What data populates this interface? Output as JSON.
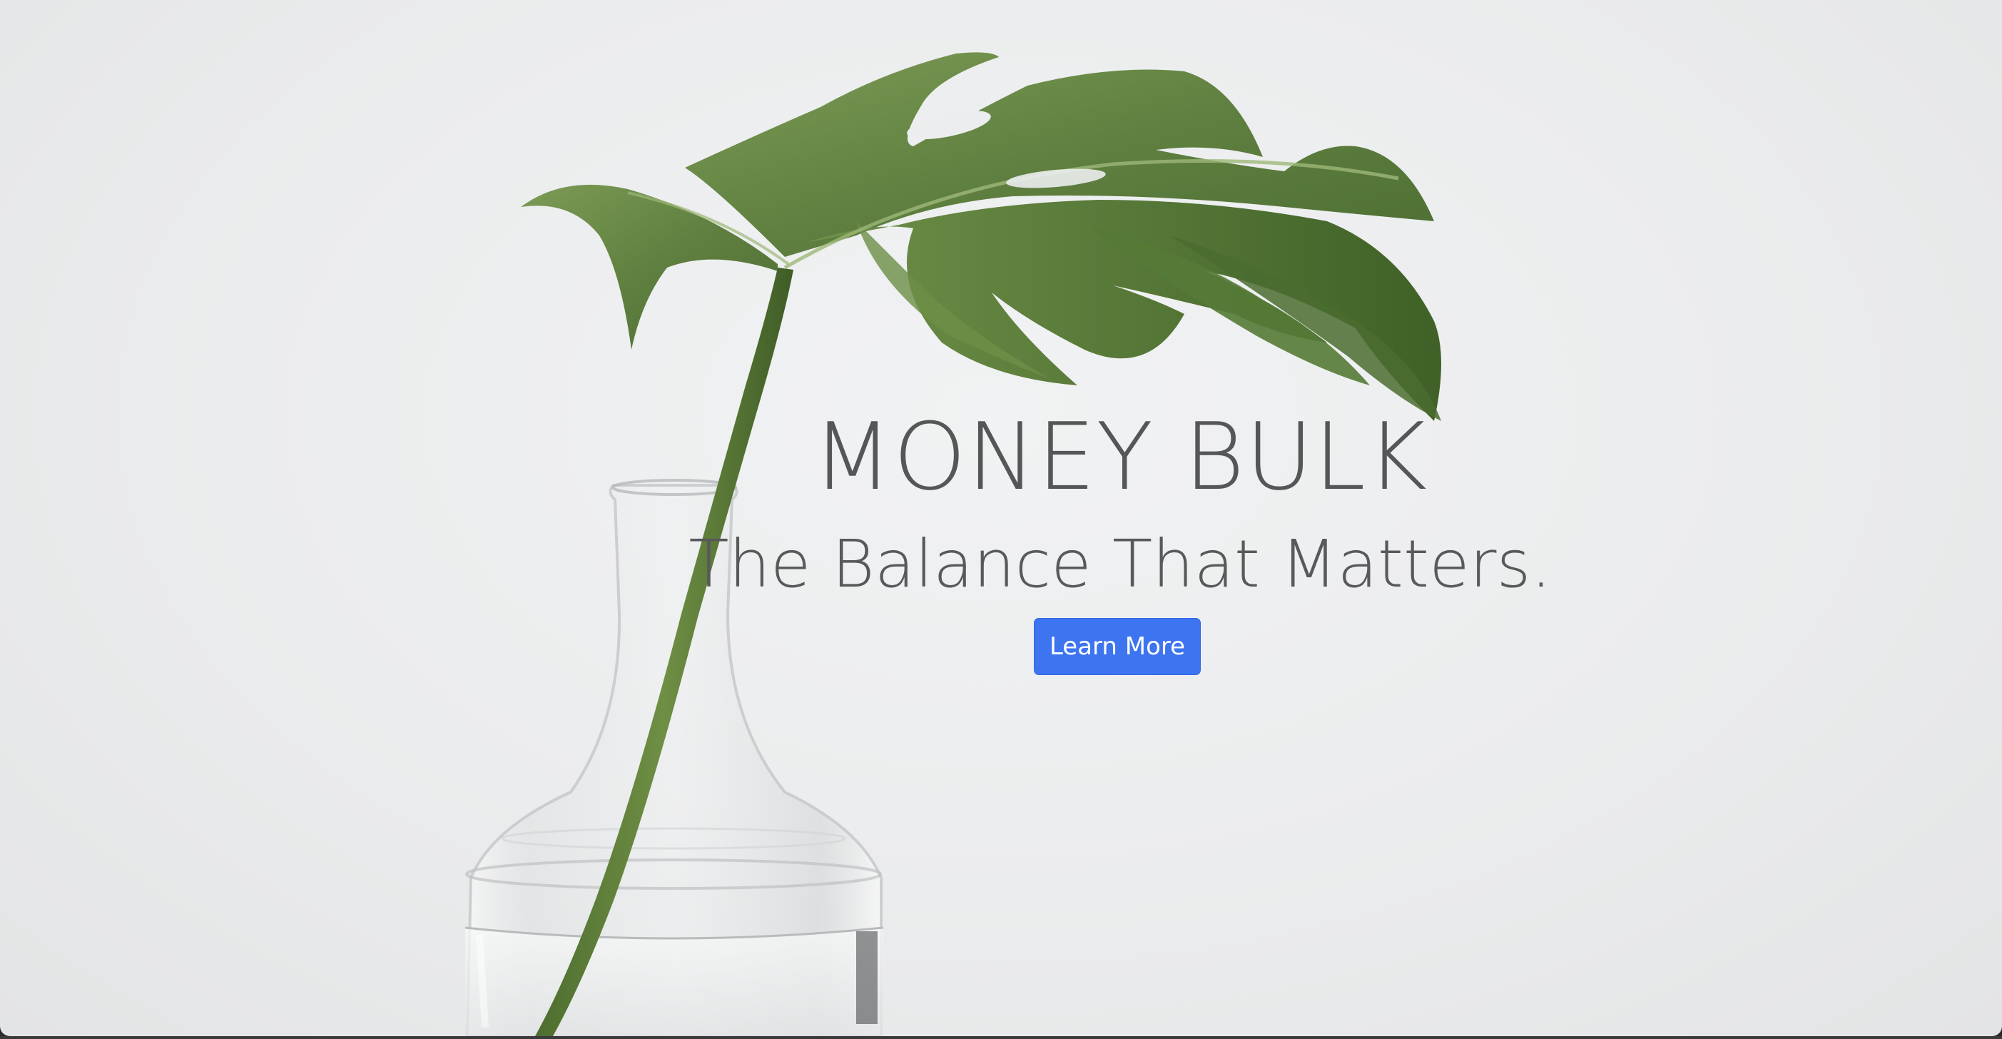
{
  "hero": {
    "title": "MONEY BULK",
    "subtitle": "The Balance That Matters.",
    "cta_label": "Learn More"
  },
  "colors": {
    "accent": "#3d74f0",
    "text": "#555657",
    "background": "#ecedee"
  },
  "image": {
    "subject": "monstera-leaf-in-glass-vase"
  }
}
